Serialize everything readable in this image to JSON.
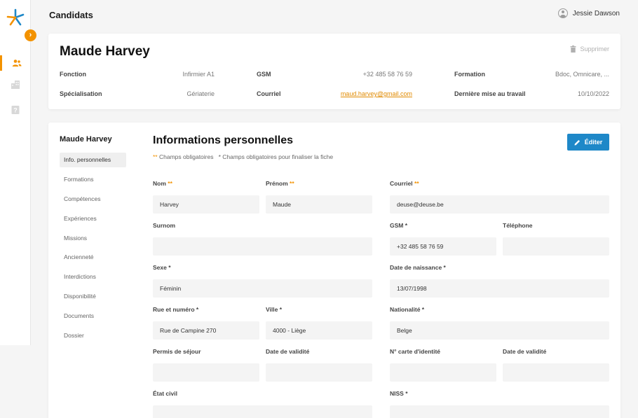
{
  "page_title": "Candidats",
  "user": {
    "name": "Jessie Dawson"
  },
  "colors": {
    "accent": "#f39200",
    "primary": "#1e88c8"
  },
  "rail": {
    "items": [
      {
        "icon": "users-icon",
        "active": true
      },
      {
        "icon": "building-icon",
        "active": false
      },
      {
        "icon": "help-icon",
        "active": false
      }
    ]
  },
  "header": {
    "name": "Maude Harvey",
    "delete_label": "Supprimer",
    "fonction_label": "Fonction",
    "fonction_value": "Infirmier A1",
    "specialisation_label": "Spécialisation",
    "specialisation_value": "Gériaterie",
    "gsm_label": "GSM",
    "gsm_value": "+32 485 58 76 59",
    "courriel_label": "Courriel",
    "courriel_value": "maud.harvey@gmail.com",
    "formation_label": "Formation",
    "formation_value": "Bdoc, Omnicare, ...",
    "maj_label": "Dernière mise au travail",
    "maj_value": "10/10/2022"
  },
  "sidebar": {
    "name": "Maude Harvey",
    "items": [
      {
        "label": "Info. personnelles",
        "active": true
      },
      {
        "label": "Formations",
        "active": false
      },
      {
        "label": "Compétences",
        "active": false
      },
      {
        "label": "Expériences",
        "active": false
      },
      {
        "label": "Missions",
        "active": false
      },
      {
        "label": "Ancienneté",
        "active": false
      },
      {
        "label": "Interdictions",
        "active": false
      },
      {
        "label": "Disponibilité",
        "active": false
      },
      {
        "label": "Documents",
        "active": false
      },
      {
        "label": "Dossier",
        "active": false
      }
    ]
  },
  "section": {
    "title": "Informations personnelles",
    "edit_label": "Éditer",
    "legend_mandatory": "Champs obligatoires",
    "legend_finalize": "Champs obligatoires pour finaliser la fiche"
  },
  "fields": {
    "nom": {
      "label": "Nom",
      "req": "**",
      "value": "Harvey"
    },
    "prenom": {
      "label": "Prénom",
      "req": "**",
      "value": "Maude"
    },
    "courriel": {
      "label": "Courriel",
      "req": "**",
      "value": "deuse@deuse.be"
    },
    "surnom": {
      "label": "Surnom",
      "value": ""
    },
    "gsm": {
      "label": "GSM *",
      "value": "+32 485 58 76 59"
    },
    "telephone": {
      "label": "Téléphone",
      "value": ""
    },
    "sexe": {
      "label": "Sexe *",
      "value": "Féminin"
    },
    "naissance": {
      "label": "Date de naissance *",
      "value": "13/07/1998"
    },
    "rue": {
      "label": "Rue et numéro *",
      "value": "Rue de Campine 270"
    },
    "ville": {
      "label": "Ville *",
      "value": "4000 - Liège"
    },
    "nationalite": {
      "label": "Nationalité *",
      "value": "Belge"
    },
    "permis": {
      "label": "Permis de séjour",
      "value": ""
    },
    "validite1": {
      "label": "Date de validité",
      "value": ""
    },
    "carte_id": {
      "label": "N° carte d'identité",
      "value": ""
    },
    "validite2": {
      "label": "Date de validité",
      "value": ""
    },
    "etat_civil": {
      "label": "État civil",
      "value": ""
    },
    "niss": {
      "label": "NISS *",
      "value": ""
    }
  }
}
